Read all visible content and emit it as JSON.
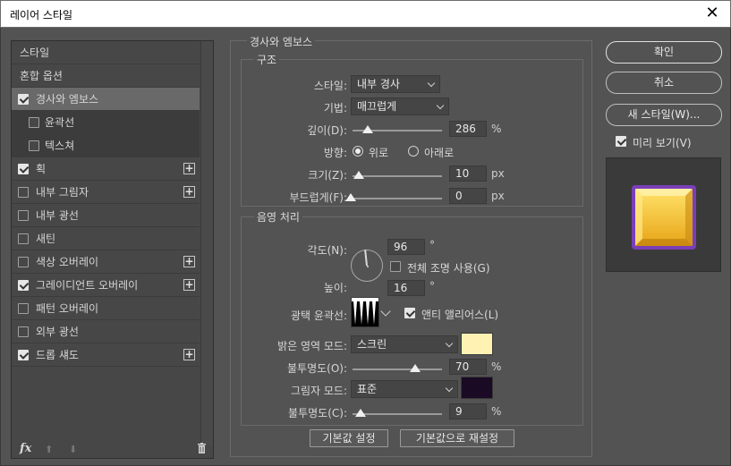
{
  "window": {
    "title": "레이어 스타일",
    "close": "✕"
  },
  "left": {
    "header1": "스타일",
    "header2": "혼합 옵션",
    "items": [
      {
        "label": "경사와 엠보스",
        "checked": true,
        "plus": false
      },
      {
        "label": "윤곽선",
        "checked": false,
        "plus": false
      },
      {
        "label": "텍스쳐",
        "checked": false,
        "plus": false
      },
      {
        "label": "획",
        "checked": true,
        "plus": true
      },
      {
        "label": "내부 그림자",
        "checked": false,
        "plus": true
      },
      {
        "label": "내부 광선",
        "checked": false,
        "plus": false
      },
      {
        "label": "새틴",
        "checked": false,
        "plus": false
      },
      {
        "label": "색상 오버레이",
        "checked": false,
        "plus": true
      },
      {
        "label": "그레이디언트 오버레이",
        "checked": true,
        "plus": true
      },
      {
        "label": "패턴 오버레이",
        "checked": false,
        "plus": false
      },
      {
        "label": "외부 광선",
        "checked": false,
        "plus": false
      },
      {
        "label": "드롭 섀도",
        "checked": true,
        "plus": true
      }
    ],
    "footer": {
      "fx": "fx",
      "up": "⬆",
      "down": "⬇",
      "trash": "🗑"
    }
  },
  "bevel": {
    "title": "경사와 엠보스",
    "structure": {
      "title": "구조",
      "style_label": "스타일:",
      "style_value": "내부 경사",
      "technique_label": "기법:",
      "technique_value": "매끄럽게",
      "depth_label": "깊이(D):",
      "depth_value": "286",
      "depth_unit": "%",
      "direction_label": "방향:",
      "dir_up": "위로",
      "dir_down": "아래로",
      "size_label": "크기(Z):",
      "size_value": "10",
      "size_unit": "px",
      "soften_label": "부드럽게(F):",
      "soften_value": "0",
      "soften_unit": "px"
    },
    "shading": {
      "title": "음영 처리",
      "angle_label": "각도(N):",
      "angle_value": "96",
      "angle_unit": "°",
      "global_light": "전체 조명 사용(G)",
      "altitude_label": "높이:",
      "altitude_value": "16",
      "altitude_unit": "°",
      "gloss_label": "광택 윤곽선:",
      "antialias": "앤티 앨리어스(L)",
      "highlight_label": "밝은 영역 모드:",
      "highlight_value": "스크린",
      "highlight_color": "#fff2b3",
      "opacity1_label": "불투명도(O):",
      "opacity1_value": "70",
      "opacity_unit": "%",
      "shadow_label": "그림자 모드:",
      "shadow_value": "표준",
      "shadow_color": "#1a0a24",
      "opacity2_label": "불투명도(C):",
      "opacity2_value": "9"
    },
    "btn_default": "기본값 설정",
    "btn_reset": "기본값으로 재설정"
  },
  "right": {
    "ok": "확인",
    "cancel": "취소",
    "new_style": "새 스타일(W)...",
    "preview": "미리 보기(V)"
  }
}
